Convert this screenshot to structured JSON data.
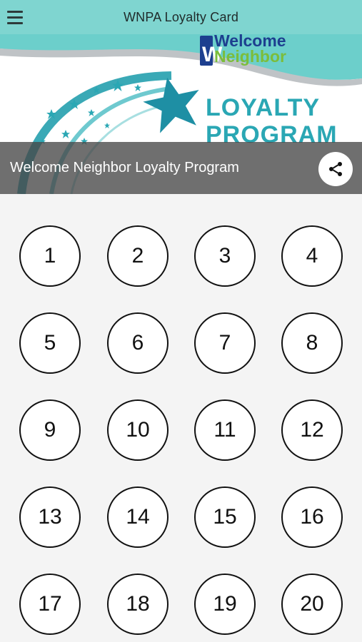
{
  "header": {
    "title": "WNPA Loyalty Card",
    "menu_icon": "hamburger-menu-icon"
  },
  "banner": {
    "logo_line1": "Welcome",
    "logo_line2": "Neighbor",
    "headline_line1": "LOYALTY",
    "headline_line2": "PROGRAM",
    "caption": "Welcome Neighbor Loyalty Program",
    "share_icon": "share-icon",
    "colors": {
      "teal": "#2aa7b4",
      "green": "#7bbd3b",
      "navy": "#1d3f8f"
    }
  },
  "stamps": [
    "1",
    "2",
    "3",
    "4",
    "5",
    "6",
    "7",
    "8",
    "9",
    "10",
    "11",
    "12",
    "13",
    "14",
    "15",
    "16",
    "17",
    "18",
    "19",
    "20"
  ]
}
